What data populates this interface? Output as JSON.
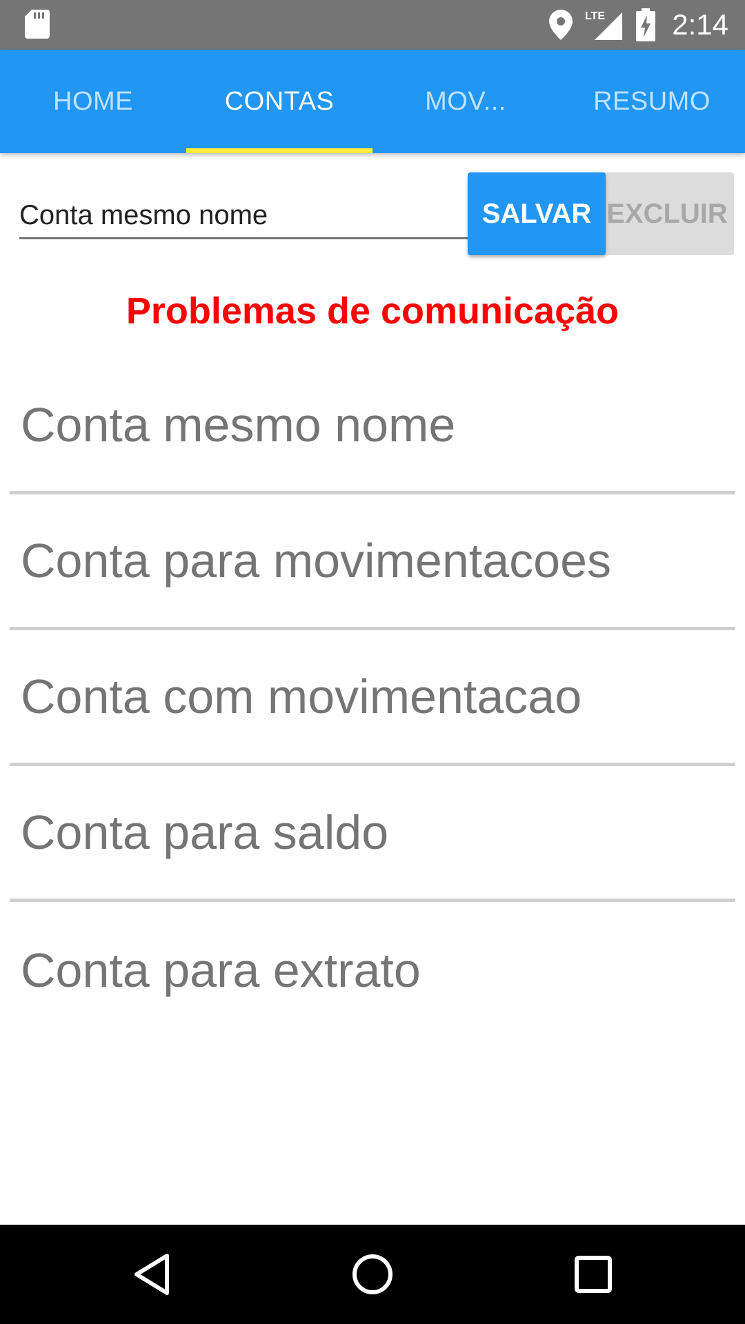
{
  "status_bar": {
    "network": "LTE",
    "time": "2:14",
    "icons": [
      "sd-card-icon",
      "location-icon",
      "signal-icon",
      "battery-charging-icon"
    ]
  },
  "tabs": [
    {
      "label": "HOME",
      "active": false
    },
    {
      "label": "CONTAS",
      "active": true
    },
    {
      "label": "MOV...",
      "active": false
    },
    {
      "label": "RESUMO",
      "active": false
    }
  ],
  "form": {
    "name_value": "Conta mesmo nome",
    "save_label": "SALVAR",
    "delete_label": "EXCLUIR"
  },
  "error_message": "Problemas de comunicação",
  "accounts": [
    {
      "name": "Conta mesmo nome"
    },
    {
      "name": "Conta para movimentacoes"
    },
    {
      "name": "Conta com movimentacao"
    },
    {
      "name": "Conta para saldo"
    },
    {
      "name": "Conta para extrato"
    }
  ],
  "navigation": {
    "icons": [
      "back-icon",
      "home-icon",
      "recents-icon"
    ]
  },
  "colors": {
    "status_bar": "#757575",
    "app_bar": "#2196f3",
    "tab_indicator": "#ffeb3b",
    "error": "#ff0000",
    "list_text": "#757575"
  }
}
